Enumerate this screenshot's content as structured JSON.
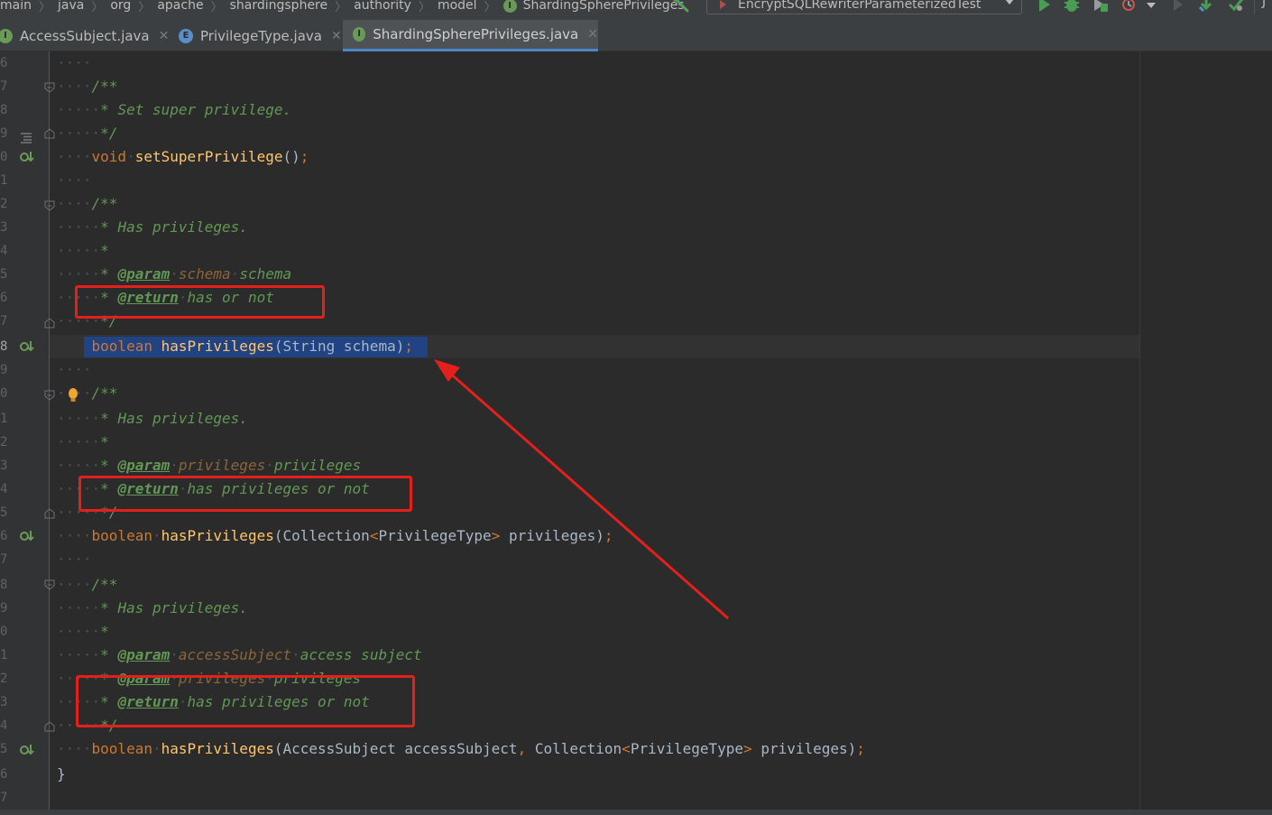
{
  "breadcrumbs": [
    "main",
    "java",
    "org",
    "apache",
    "shardingsphere",
    "authority",
    "model",
    "ShardingSpherePrivileges"
  ],
  "breadcrumb_file_badge": "I",
  "run_config": {
    "label": "EncryptSQLRewriterParameterizedTest"
  },
  "toolbar": {
    "trailing_label": "J"
  },
  "tabs": [
    {
      "label": "AccessSubject.java",
      "badge": "I",
      "active": false
    },
    {
      "label": "PrivilegeType.java",
      "badge": "E",
      "active": false
    },
    {
      "label": "ShardingSpherePrivileges.java",
      "badge": "I",
      "active": true
    }
  ],
  "line_numbers": [
    "6",
    "7",
    "8",
    "9",
    "0",
    "1",
    "2",
    "3",
    "4",
    "5",
    "6",
    "7",
    "8",
    "9",
    "0",
    "1",
    "2",
    "3",
    "4",
    "5",
    "6",
    "7",
    "8",
    "9",
    "0",
    "1",
    "2",
    "3",
    "4",
    "5",
    "6",
    "7"
  ],
  "code": {
    "l6": "",
    "l7": "/**",
    "l8": "* Set super privilege.",
    "l9": "*/",
    "l10_kw": "void",
    "l10_fn": "setSuperPrivilege",
    "l10_rest": "()",
    "l10_semi": ";",
    "l12": "/**",
    "l13": "* Has privileges.",
    "l14": "*",
    "l15_star": "* ",
    "l15_tag": "@param",
    "l15_name": "schema",
    "l15_desc": "schema",
    "l16_star": "* ",
    "l16_tag": "@return",
    "l16_desc": "has or not",
    "l17": "*/",
    "l18_kw": "boolean",
    "l18_fn": "hasPrivileges",
    "l18_rest": "(String schema)",
    "l18_semi": ";",
    "l20": "/**",
    "l21": "* Has privileges.",
    "l22": "*",
    "l23_star": "* ",
    "l23_tag": "@param",
    "l23_name": "privileges",
    "l23_desc": "privileges",
    "l24_star": "* ",
    "l24_tag": "@return",
    "l24_desc": "has privileges or not",
    "l25": "*/",
    "l26_kw": "boolean",
    "l26_fn": "hasPrivileges",
    "l26_p1": "(Collection",
    "l26_lt": "<",
    "l26_ty": "PrivilegeType",
    "l26_gt": ">",
    "l26_p2": " privileges)",
    "l26_semi": ";",
    "l28": "/**",
    "l29": "* Has privileges.",
    "l30": "*",
    "l31_star": "* ",
    "l31_tag": "@param",
    "l31_name": "accessSubject",
    "l31_desc": "access subject",
    "l32_star": "* ",
    "l32_tag": "@param",
    "l32_name": "privileges",
    "l32_desc": "privileges",
    "l33_star": "* ",
    "l33_tag": "@return",
    "l33_desc": "has privileges or not",
    "l34": "*/",
    "l35_kw": "boolean",
    "l35_fn": "hasPrivileges",
    "l35_p1": "(AccessSubject accessSubject",
    "l35_comma": ",",
    "l35_p2": " Collection",
    "l35_lt": "<",
    "l35_ty": "PrivilegeType",
    "l35_gt": ">",
    "l35_p3": " privileges)",
    "l35_semi": ";",
    "l36": "}"
  },
  "colors": {
    "annotation_red": "#e3201b",
    "selection": "#214283",
    "keyword": "#cc7832",
    "method": "#ffc66d",
    "comment": "#629755"
  }
}
